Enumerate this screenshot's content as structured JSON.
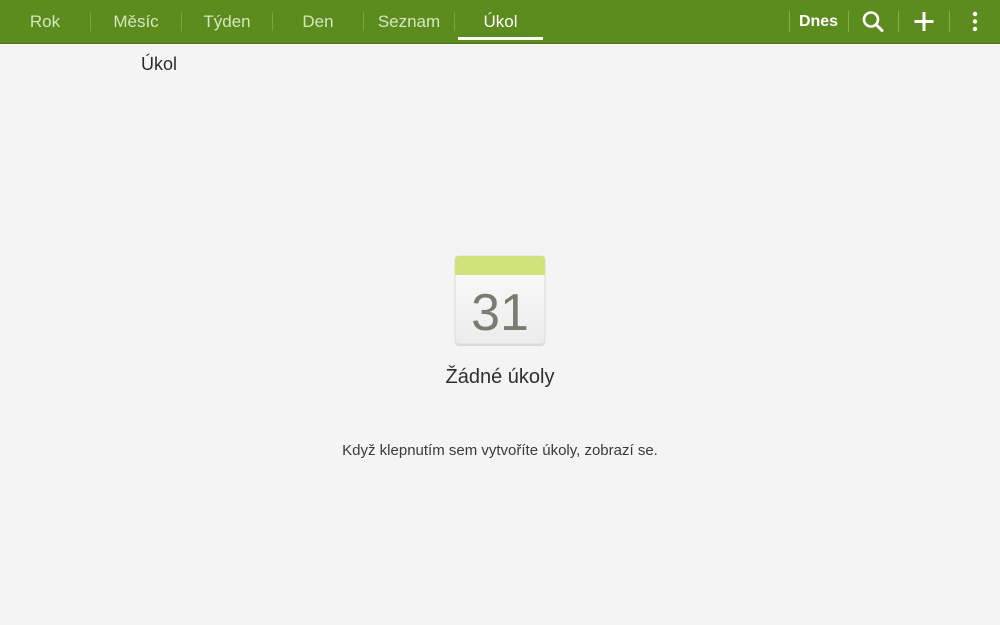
{
  "tabs": [
    {
      "label": "Rok",
      "active": false
    },
    {
      "label": "Měsíc",
      "active": false
    },
    {
      "label": "Týden",
      "active": false
    },
    {
      "label": "Den",
      "active": false
    },
    {
      "label": "Seznam",
      "active": false
    },
    {
      "label": "Úkol",
      "active": true
    }
  ],
  "actions": {
    "today_label": "Dnes",
    "search_icon": "search-icon",
    "add_icon": "plus-icon",
    "menu_icon": "overflow-menu-icon"
  },
  "main": {
    "section_title": "Úkol",
    "empty_icon_number": "31",
    "empty_title": "Žádné úkoly",
    "empty_hint": "Když klepnutím sem vytvoříte úkoly, zobrazí se."
  },
  "colors": {
    "actionbar": "#5b8c1d",
    "tab_inactive_text": "#d6e6bf",
    "tab_active_text": "#ffffff",
    "background": "#f4f4f4",
    "calendar_header": "#cfe27c"
  }
}
